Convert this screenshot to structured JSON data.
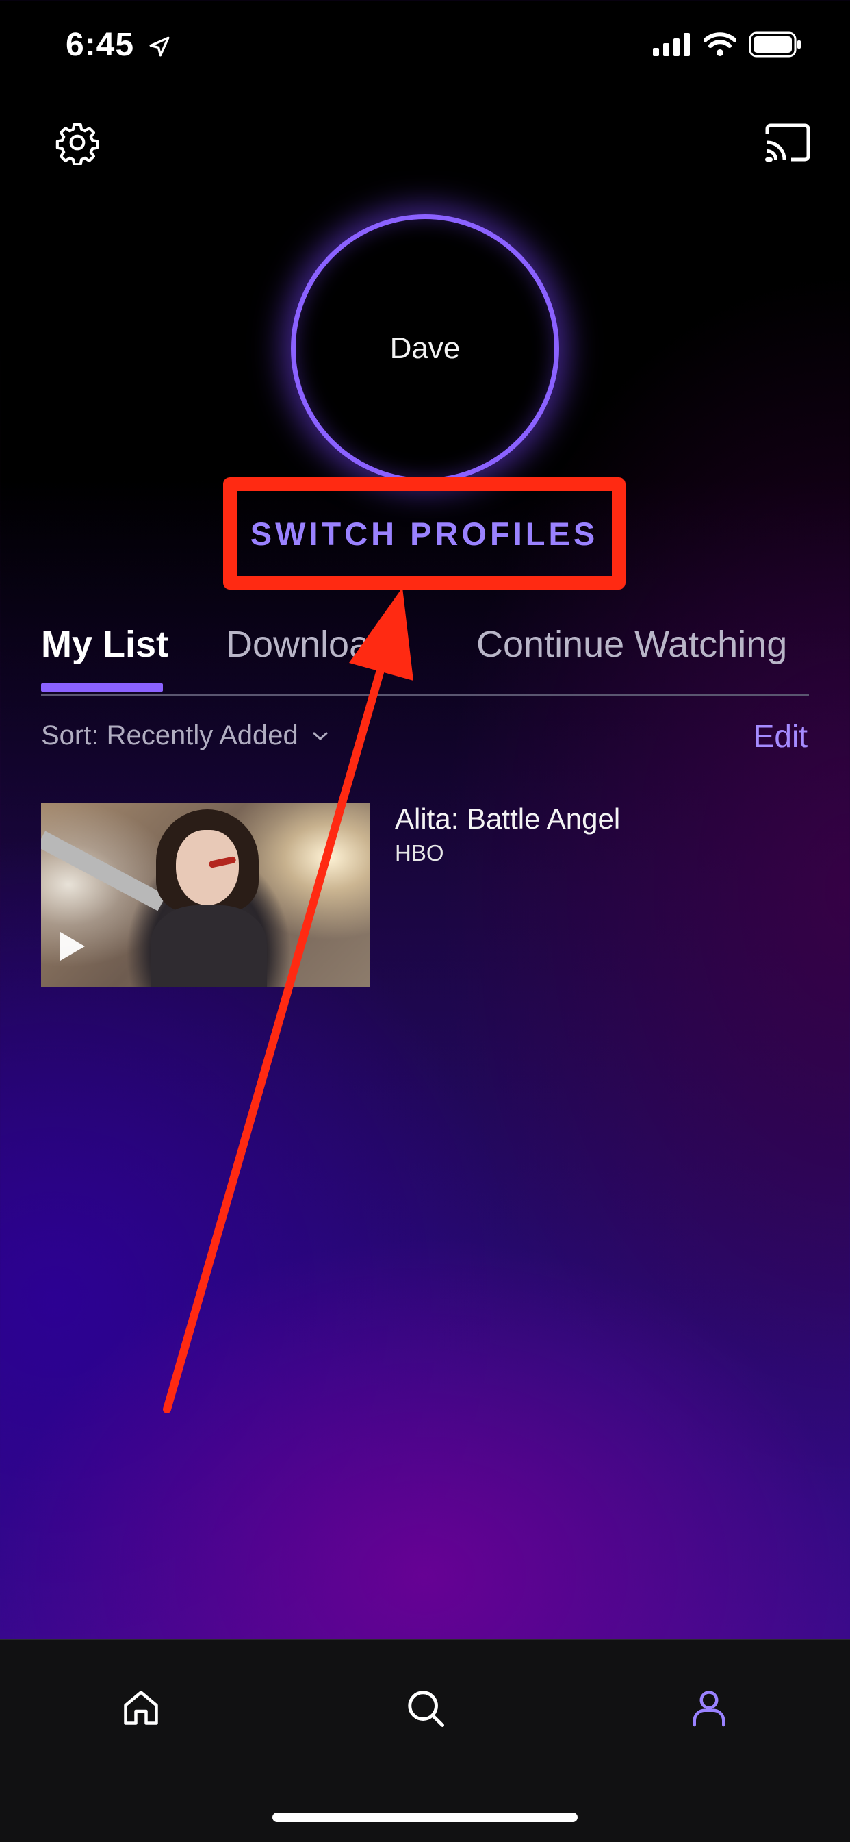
{
  "status_bar": {
    "time": "6:45",
    "icons": [
      "location-arrow-icon",
      "cellular-signal-icon",
      "wifi-icon",
      "battery-icon"
    ]
  },
  "header": {
    "settings_icon": "gear-icon",
    "cast_icon": "cast-icon"
  },
  "profile": {
    "name": "Dave",
    "switch_label": "SWITCH PROFILES"
  },
  "tabs": [
    {
      "label": "My List",
      "selected": true
    },
    {
      "label": "Downloads",
      "selected": false
    },
    {
      "label": "Continue Watching",
      "selected": false
    }
  ],
  "sort": {
    "label": "Sort: Recently Added",
    "icon": "chevron-down-icon"
  },
  "edit_label": "Edit",
  "list_items": [
    {
      "title": "Alita: Battle Angel",
      "network": "HBO",
      "icon": "play-icon"
    }
  ],
  "bottom_nav": [
    {
      "icon": "home-icon",
      "selected": false
    },
    {
      "icon": "search-icon",
      "selected": false
    },
    {
      "icon": "profile-icon",
      "selected": true
    }
  ],
  "colors": {
    "accent": "#8b62ff",
    "annotation": "#ff2a12",
    "tabbar_bg": "#111112"
  }
}
